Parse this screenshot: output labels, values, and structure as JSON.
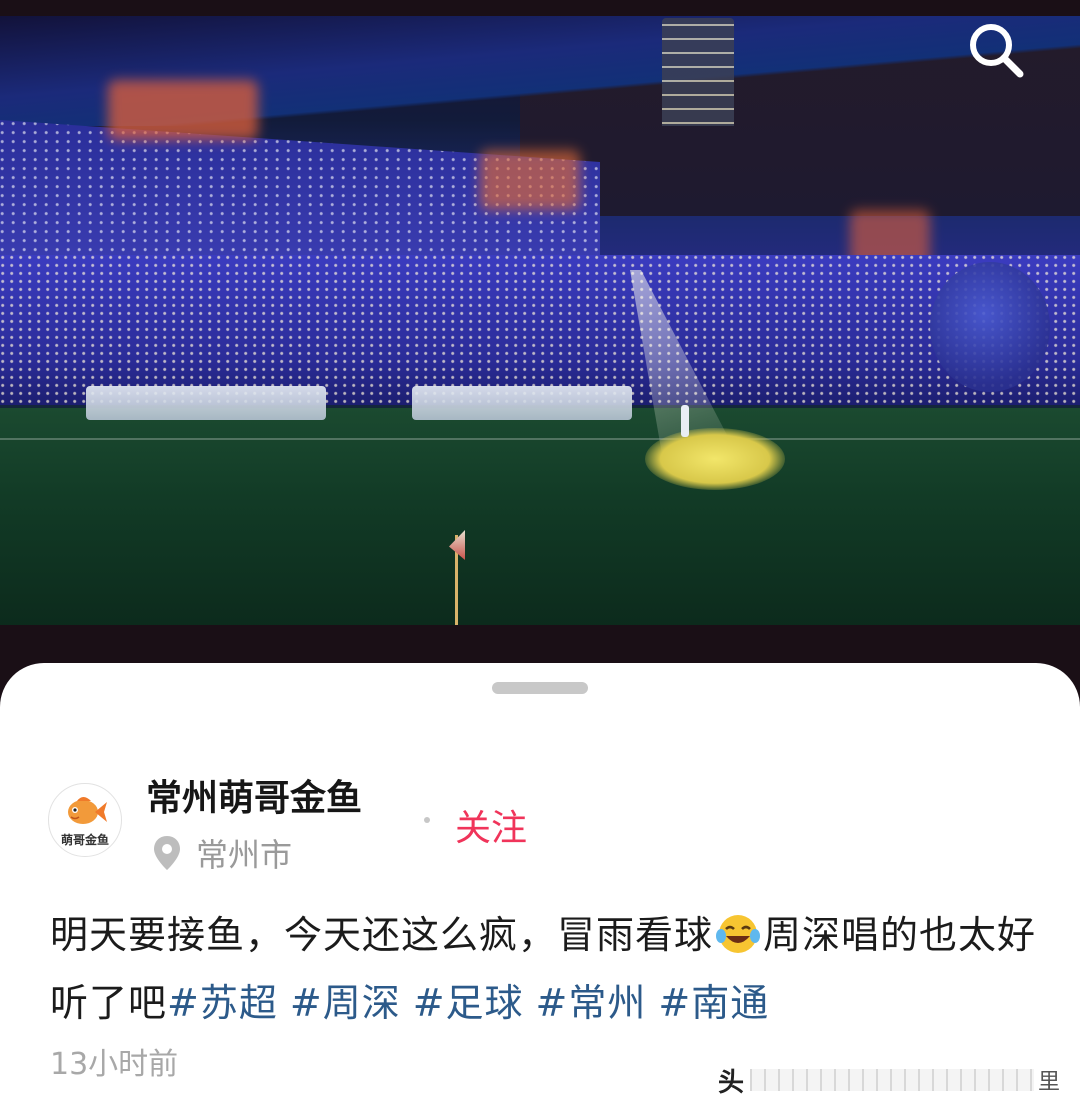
{
  "photo": {
    "description_icon": "search-icon"
  },
  "post": {
    "author": "常州萌哥金鱼",
    "avatar_text": "萌哥金鱼",
    "location": "常州市",
    "follow_label": "关注",
    "text": "明天要接鱼，今天还这么疯，冒雨看球",
    "text_after_emoji": "周深唱的也太好听了吧",
    "emoji": "😂",
    "hashtags": [
      "#苏超",
      "#周深",
      "#足球",
      "#常州",
      "#南通"
    ],
    "time": "13小时前"
  },
  "watermark": {
    "left": "头",
    "right": "里"
  },
  "colors": {
    "follow": "#f0345a",
    "hashtag": "#2c5a8a"
  }
}
